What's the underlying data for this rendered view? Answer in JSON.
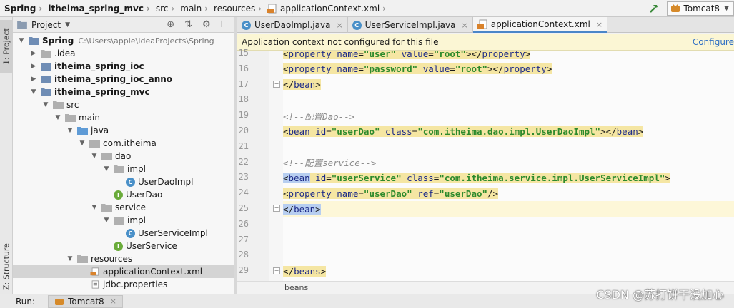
{
  "breadcrumb": [
    {
      "label": "Spring",
      "bold": true,
      "icon": "folder-icon"
    },
    {
      "label": "itheima_spring_mvc",
      "bold": true,
      "icon": "folder-icon"
    },
    {
      "label": "src",
      "bold": false,
      "icon": "folder-icon"
    },
    {
      "label": "main",
      "bold": false,
      "icon": "folder-icon"
    },
    {
      "label": "resources",
      "bold": false,
      "icon": "folder-icon"
    },
    {
      "label": "applicationContext.xml",
      "bold": false,
      "icon": "xml-file-icon"
    }
  ],
  "run_config": {
    "label": "Tomcat8"
  },
  "left_strip": {
    "project_tab": "1: Project",
    "structure_tab": "Z: Structure"
  },
  "project_panel": {
    "title": "Project",
    "tree": [
      {
        "label": "Spring",
        "path": "C:\\Users\\apple\\IdeaProjects\\Spring",
        "indent": 0,
        "arrow": "down",
        "icon": "module",
        "bold": true
      },
      {
        "label": ".idea",
        "indent": 1,
        "arrow": "right",
        "icon": "folder"
      },
      {
        "label": "itheima_spring_ioc",
        "indent": 1,
        "arrow": "right",
        "icon": "module",
        "bold": true
      },
      {
        "label": "itheima_spring_ioc_anno",
        "indent": 1,
        "arrow": "right",
        "icon": "module",
        "bold": true
      },
      {
        "label": "itheima_spring_mvc",
        "indent": 1,
        "arrow": "down",
        "icon": "module",
        "bold": true
      },
      {
        "label": "src",
        "indent": 2,
        "arrow": "down",
        "icon": "folder"
      },
      {
        "label": "main",
        "indent": 3,
        "arrow": "down",
        "icon": "folder"
      },
      {
        "label": "java",
        "indent": 4,
        "arrow": "down",
        "icon": "source-folder"
      },
      {
        "label": "com.itheima",
        "indent": 5,
        "arrow": "down",
        "icon": "package"
      },
      {
        "label": "dao",
        "indent": 6,
        "arrow": "down",
        "icon": "package"
      },
      {
        "label": "impl",
        "indent": 7,
        "arrow": "down",
        "icon": "package"
      },
      {
        "label": "UserDaoImpl",
        "indent": 8,
        "arrow": "none",
        "icon": "class"
      },
      {
        "label": "UserDao",
        "indent": 7,
        "arrow": "none",
        "icon": "interface"
      },
      {
        "label": "service",
        "indent": 6,
        "arrow": "down",
        "icon": "package"
      },
      {
        "label": "impl",
        "indent": 7,
        "arrow": "down",
        "icon": "package"
      },
      {
        "label": "UserServiceImpl",
        "indent": 8,
        "arrow": "none",
        "icon": "class"
      },
      {
        "label": "UserService",
        "indent": 7,
        "arrow": "none",
        "icon": "interface"
      },
      {
        "label": "resources",
        "indent": 4,
        "arrow": "down",
        "icon": "resource-folder"
      },
      {
        "label": "applicationContext.xml",
        "indent": 5,
        "arrow": "none",
        "icon": "xml",
        "selected": true
      },
      {
        "label": "jdbc.properties",
        "indent": 5,
        "arrow": "none",
        "icon": "properties"
      }
    ]
  },
  "tabs": [
    {
      "label": "UserDaoImpl.java",
      "icon": "class",
      "active": false
    },
    {
      "label": "UserServiceImpl.java",
      "icon": "class",
      "active": false
    },
    {
      "label": "applicationContext.xml",
      "icon": "xml",
      "active": true
    }
  ],
  "banner": {
    "message": "Application context not configured for this file",
    "action": "Configure"
  },
  "editor": {
    "lines": [
      {
        "n": "15",
        "html": "        <span class=\"hl\">&lt;<span class=\"t\">property</span> <span class=\"an\">name</span>=<span class=\"av\">\"user\"</span> <span class=\"an\">value</span>=<span class=\"av\">\"root\"</span>&gt;&lt;/<span class=\"t\">property</span>&gt;</span>"
      },
      {
        "n": "16",
        "html": "        <span class=\"hl\">&lt;<span class=\"t\">property</span> <span class=\"an\">name</span>=<span class=\"av\">\"password\"</span> <span class=\"an\">value</span>=<span class=\"av\">\"root\"</span>&gt;&lt;/<span class=\"t\">property</span>&gt;</span>"
      },
      {
        "n": "17",
        "html": "    <span class=\"hl\">&lt;/<span class=\"t\">bean</span>&gt;</span>"
      },
      {
        "n": "18",
        "html": ""
      },
      {
        "n": "19",
        "html": "    <span class=\"cm\">&lt;!--配置Dao--&gt;</span>"
      },
      {
        "n": "20",
        "html": "    <span class=\"hl\">&lt;<span class=\"t\">bean</span> <span class=\"an\">id</span>=<span class=\"av\">\"userDao\"</span> <span class=\"an\">class</span>=<span class=\"av\">\"com.itheima.dao.impl.UserDaoImpl\"</span>&gt;&lt;/<span class=\"t\">bean</span>&gt;</span>"
      },
      {
        "n": "21",
        "html": ""
      },
      {
        "n": "22",
        "html": "    <span class=\"cm\">&lt;!--配置service--&gt;</span>"
      },
      {
        "n": "23",
        "html": "    <span class=\"hlsel\">&lt;<span class=\"t\">bean</span></span><span class=\"hl\"> <span class=\"an\">id</span>=<span class=\"av\">\"userService\"</span> <span class=\"an\">class</span>=<span class=\"av\">\"com.itheima.service.impl.UserServiceImpl\"</span>&gt;</span>"
      },
      {
        "n": "24",
        "html": "        <span class=\"hl\">&lt;<span class=\"t\">property</span> <span class=\"an\">name</span>=<span class=\"av\">\"userDao\"</span> <span class=\"an\">ref</span>=<span class=\"av\">\"userDao\"</span>/&gt;</span>"
      },
      {
        "n": "25",
        "html": "    <span class=\"hlsel\">&lt;/<span class=\"t\">bean</span>&gt;</span>",
        "current": true
      },
      {
        "n": "26",
        "html": ""
      },
      {
        "n": "27",
        "html": ""
      },
      {
        "n": "28",
        "html": ""
      },
      {
        "n": "29",
        "html": "<span class=\"hl\">&lt;/<span class=\"t\">beans</span>&gt;</span>"
      }
    ]
  },
  "editor_breadcrumb": "beans",
  "run_bar": {
    "label": "Run:",
    "tab": "Tomcat8"
  },
  "watermark": "CSDN @苏打饼干没加心",
  "colors": {
    "accent": "#4a86c8",
    "banner": "#fbf6d4",
    "tag": "#1c2a88",
    "string": "#2c8a2c"
  }
}
